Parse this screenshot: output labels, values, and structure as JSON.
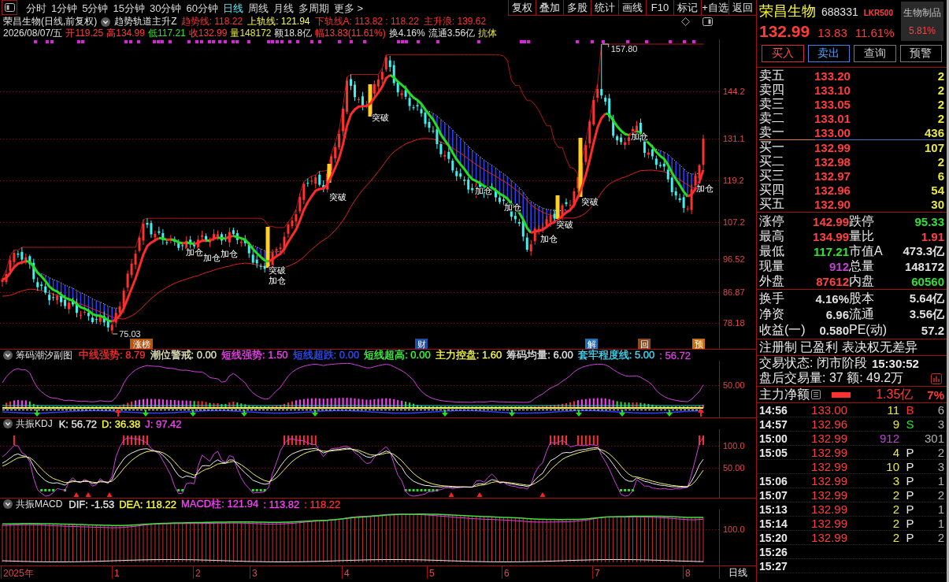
{
  "toolbar": {
    "periods": [
      {
        "label": "分时",
        "selected": false
      },
      {
        "label": "1分钟",
        "selected": false
      },
      {
        "label": "5分钟",
        "selected": false
      },
      {
        "label": "15分钟",
        "selected": false
      },
      {
        "label": "30分钟",
        "selected": false
      },
      {
        "label": "60分钟",
        "selected": false
      },
      {
        "label": "日线",
        "selected": true
      },
      {
        "label": "周线",
        "selected": false
      },
      {
        "label": "月线",
        "selected": false
      },
      {
        "label": "多周期",
        "selected": false
      },
      {
        "label": "更多 >",
        "selected": false
      }
    ],
    "buttons": [
      "复权",
      "叠加",
      "多股",
      "统计",
      "画线",
      "F10",
      "标记",
      "+自选",
      "返回"
    ]
  },
  "chart_header": {
    "title": "荣昌生物(日线,前复权)",
    "indicator": "趋势轨道主升Z",
    "values": [
      {
        "text": "趋势线: 118.22",
        "color": "#ff3030"
      },
      {
        "text": "上轨线: 121.94",
        "color": "#ffff40"
      },
      {
        "text": "下轨线A: 113.82 : 118.22",
        "color": "#ff3030"
      },
      {
        "text": "主升浪: 139.62",
        "color": "#ff3030"
      }
    ]
  },
  "quote_line": [
    {
      "text": "2026/08/07/五",
      "color": "#e0e0e0"
    },
    {
      "text": "开119.25",
      "color": "#ff3c3c"
    },
    {
      "text": "高134.99",
      "color": "#ff3c3c"
    },
    {
      "text": "低117.21",
      "color": "#30e030"
    },
    {
      "text": "收132.99",
      "color": "#ff3c3c"
    },
    {
      "text": "量148172",
      "color": "#e8e840"
    },
    {
      "text": "额18.8亿",
      "color": "#e0e0e0"
    },
    {
      "text": "幅13.83(11.61%)",
      "color": "#ff3c3c"
    },
    {
      "text": "换4.16%",
      "color": "#e0e0e0"
    },
    {
      "text": "流通3.56亿",
      "color": "#e0e0e0"
    },
    {
      "text": "抗体",
      "color": "#e8e840"
    }
  ],
  "main_chart": {
    "price_axis": [
      "144.2",
      "131.1",
      "119.2",
      "107.2",
      "96.52",
      "86.87",
      "78.18"
    ],
    "high_mark": "157.80",
    "low_mark": "75.03",
    "signals": [
      "加仓",
      "加仓",
      "加仓",
      "突破",
      "加仓",
      "突破",
      "突破",
      "加仓",
      "加仓",
      "加仓",
      "突破",
      "突破",
      "加仓",
      "加仓"
    ],
    "events": [
      {
        "label": "涨榜",
        "color": "#b8560e"
      },
      {
        "label": "财",
        "color": "#1d4fa8"
      },
      {
        "label": "解",
        "color": "#2270b8"
      },
      {
        "label": "回",
        "color": "#8a4a1a"
      },
      {
        "label": "预",
        "color": "#c8700e"
      }
    ]
  },
  "panes": [
    {
      "title": "筹码潮汐副图",
      "values": [
        {
          "text": "中线强势: 8.79",
          "color": "#ff3030"
        },
        {
          "text": "潮位警戒: 0.00",
          "color": "#e8e8c0"
        },
        {
          "text": "短线强势: 1.50",
          "color": "#ff40ff"
        },
        {
          "text": "短线超跌: 0.00",
          "color": "#3050ff"
        },
        {
          "text": "短线超高: 0.00",
          "color": "#40ff40"
        },
        {
          "text": "主力控盘: 1.60",
          "color": "#ffff40"
        },
        {
          "text": "筹码均量: 6.00",
          "color": "#e8e8e8"
        },
        {
          "text": "套牢程度线: 5.00",
          "color": "#40e0ff"
        },
        {
          "text": ": 56.72",
          "color": "#e040e0"
        }
      ],
      "axis": [
        "50.00"
      ]
    },
    {
      "title": "共振KDJ",
      "values": [
        {
          "text": "K: 56.72",
          "color": "#e8e8e8"
        },
        {
          "text": "D: 36.38",
          "color": "#ffff40"
        },
        {
          "text": "J: 97.42",
          "color": "#ff40ff"
        }
      ],
      "axis": [
        "100.0",
        "50.00"
      ]
    },
    {
      "title": "共振MACD",
      "values": [
        {
          "text": "DIF: -1.53",
          "color": "#e8e8e8"
        },
        {
          "text": "DEA: 118.22",
          "color": "#ffff40"
        },
        {
          "text": "MACD柱: 121.94",
          "color": "#ff40ff"
        },
        {
          "text": ": 113.82",
          "color": "#ff40ff"
        },
        {
          "text": ": 118.22",
          "color": "#ff3030"
        }
      ],
      "axis": [
        "100.0"
      ]
    }
  ],
  "date_axis": {
    "labels": [
      "2025年",
      "1",
      "2",
      "3",
      "4",
      "5",
      "6",
      "7",
      "8"
    ],
    "period": "日线"
  },
  "quote": {
    "name": "荣昌生物",
    "code": "688331",
    "tag": "LKR500",
    "sector": "生物制品",
    "sector_change": "5.81%",
    "price": "132.99",
    "change": "13.83",
    "change_pct": "11.61%"
  },
  "trade_buttons": [
    {
      "label": "买入",
      "kind": "buy"
    },
    {
      "label": "卖出",
      "kind": "sell"
    },
    {
      "label": "查询",
      "kind": "plain"
    },
    {
      "label": "预警",
      "kind": "plain"
    }
  ],
  "order_book": {
    "asks": [
      {
        "label": "卖五",
        "price": "133.20",
        "volume": "2"
      },
      {
        "label": "卖四",
        "price": "133.10",
        "volume": "2"
      },
      {
        "label": "卖三",
        "price": "133.05",
        "volume": "2"
      },
      {
        "label": "卖二",
        "price": "133.01",
        "volume": "2"
      },
      {
        "label": "卖一",
        "price": "133.00",
        "volume": "436"
      }
    ],
    "bids": [
      {
        "label": "买一",
        "price": "132.99",
        "volume": "107"
      },
      {
        "label": "买二",
        "price": "132.98",
        "volume": "2"
      },
      {
        "label": "买三",
        "price": "132.97",
        "volume": "6"
      },
      {
        "label": "买四",
        "price": "132.96",
        "volume": "54"
      },
      {
        "label": "买五",
        "price": "132.90",
        "volume": "30"
      }
    ]
  },
  "market_stats": [
    {
      "cells": [
        {
          "label": "涨停",
          "value": "142.99",
          "color": "#ff4040"
        },
        {
          "label": "跌停",
          "value": "95.33",
          "color": "#30e030"
        }
      ]
    },
    {
      "cells": [
        {
          "label": "最高",
          "value": "134.99",
          "color": "#ff4040"
        },
        {
          "label": "量比",
          "value": "1.91",
          "color": "#ff4040"
        }
      ]
    },
    {
      "cells": [
        {
          "label": "最低",
          "value": "117.21",
          "color": "#30e030"
        },
        {
          "label": "市值A",
          "value": "473.3亿",
          "color": "#e0e0e0"
        }
      ]
    },
    {
      "cells": [
        {
          "label": "现量",
          "value": "912",
          "color": "#c040d0"
        },
        {
          "label": "总量",
          "value": "148172",
          "color": "#e0e0e0"
        }
      ]
    },
    {
      "cells": [
        {
          "label": "外盘",
          "value": "87612",
          "color": "#ff4040"
        },
        {
          "label": "内盘",
          "value": "60560",
          "color": "#30e030"
        }
      ]
    }
  ],
  "share_stats": [
    {
      "cells": [
        {
          "label": "换手",
          "value": "4.16%"
        },
        {
          "label": "股本",
          "value": "5.64亿"
        }
      ]
    },
    {
      "cells": [
        {
          "label": "净资",
          "value": "6.96"
        },
        {
          "label": "流通",
          "value": "3.56亿"
        }
      ]
    },
    {
      "cells": [
        {
          "label": "收益(一)",
          "value": "0.580"
        },
        {
          "label": "PE(动)",
          "value": "57.2"
        }
      ]
    }
  ],
  "notice": "注册制 已盈利 表决权无差异",
  "trading_status": {
    "label": "交易状态: 闭市阶段",
    "time": "15:30:52"
  },
  "after_hours": "盘后交易量: 37 额: 49.2万",
  "main_flow": {
    "label": "主力净额",
    "amount": "1.35亿",
    "share": "7%"
  },
  "trades": [
    {
      "time": "14:56",
      "price": "133.00",
      "volume": "11",
      "color": "#e8e840",
      "side": "B",
      "kind": "buy",
      "count": "6"
    },
    {
      "time": "14:57",
      "price": "132.96",
      "volume": "9",
      "color": "#e8e840",
      "side": "S",
      "kind": "sell",
      "count": "3"
    },
    {
      "time": "15:00",
      "price": "132.99",
      "volume": "912",
      "color": "#c040d0",
      "count": "301"
    },
    {
      "time": "15:05",
      "price": "132.99",
      "volume": "4",
      "color": "#e8e840",
      "side": "P",
      "kind": "neutral",
      "count": "2"
    },
    {
      "price": "132.99",
      "volume": "10",
      "color": "#e8e840",
      "side": "P",
      "kind": "neutral",
      "count": "3"
    },
    {
      "time": "15:06",
      "price": "132.99",
      "volume": "3",
      "color": "#e8e840",
      "side": "P",
      "kind": "neutral",
      "count": "1"
    },
    {
      "time": "15:07",
      "price": "132.99",
      "volume": "2",
      "color": "#e8e840",
      "side": "P",
      "kind": "neutral",
      "count": "2"
    },
    {
      "time": "15:13",
      "price": "132.99",
      "volume": "2",
      "color": "#e8e840",
      "side": "P",
      "kind": "neutral",
      "count": "1"
    },
    {
      "time": "15:14",
      "price": "132.99",
      "volume": "2",
      "color": "#e8e840",
      "side": "P",
      "kind": "neutral",
      "count": "1"
    },
    {
      "time": "15:20",
      "price": "132.99",
      "volume": "2",
      "color": "#e8e840",
      "side": "P",
      "kind": "neutral",
      "count": "2"
    },
    {
      "time": "15:26"
    },
    {
      "time": "15:27"
    }
  ]
}
